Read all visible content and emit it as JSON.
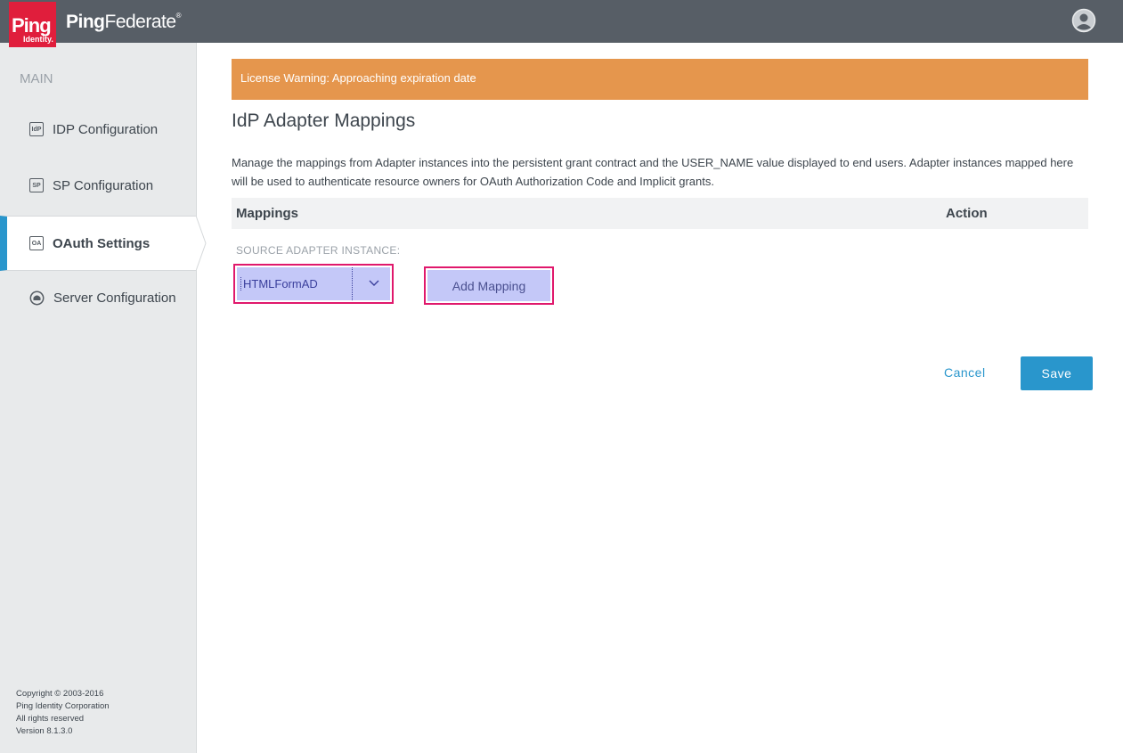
{
  "header": {
    "logo_top": "Ping",
    "logo_bottom": "Identity.",
    "product_prefix": "Ping",
    "product_suffix": "Federate",
    "product_mark": "®"
  },
  "sidebar": {
    "section": "MAIN",
    "items": [
      {
        "label": "IDP Configuration",
        "icon": "IdP",
        "active": false
      },
      {
        "label": "SP Configuration",
        "icon": "SP",
        "active": false
      },
      {
        "label": "OAuth Settings",
        "icon": "OA",
        "active": true
      },
      {
        "label": "Server Configuration",
        "icon": "server",
        "active": false
      }
    ],
    "footer": {
      "line1": "Copyright © 2003-2016",
      "line2": "Ping Identity Corporation",
      "line3": "All rights reserved",
      "line4": "Version 8.1.3.0"
    }
  },
  "main": {
    "warning": "License Warning: Approaching expiration date",
    "title": "IdP Adapter Mappings",
    "description": "Manage the mappings from Adapter instances into the persistent grant contract and the USER_NAME value displayed to end users. Adapter instances mapped here will be used to authenticate resource owners for OAuth Authorization Code and Implicit grants.",
    "table": {
      "col_mappings": "Mappings",
      "col_action": "Action"
    },
    "source_label": "SOURCE ADAPTER INSTANCE:",
    "source_value": "HTMLFormAD",
    "add_mapping": "Add Mapping",
    "cancel": "Cancel",
    "save": "Save"
  },
  "colors": {
    "header_bg": "#575e66",
    "brand_red": "#e01e3c",
    "accent_blue": "#2996cc",
    "warning_orange": "#e5964d",
    "highlight_border": "#e0186c"
  }
}
